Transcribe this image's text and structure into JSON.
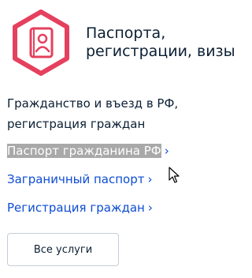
{
  "category": {
    "title_line1": "Паспорта,",
    "title_line2": "регистрации, визы",
    "icon": "passport-icon",
    "accent_color": "#e5405e"
  },
  "section": {
    "desc_line1": "Гражданство и въезд в РФ,",
    "desc_line2": "регистрация граждан"
  },
  "links": [
    {
      "label": "Паспорт гражданина РФ",
      "chevron": "›",
      "selected": true
    },
    {
      "label": "Заграничный паспорт",
      "chevron": "›"
    },
    {
      "label": "Регистрация граждан",
      "chevron": "›"
    }
  ],
  "all_services_label": "Все услуги",
  "colors": {
    "link": "#0d4cd3",
    "text": "#0b1f33",
    "selection": "#a9a9a9"
  }
}
